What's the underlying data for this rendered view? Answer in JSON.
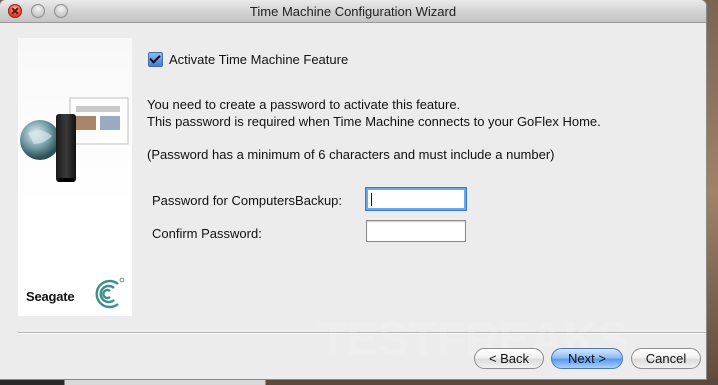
{
  "window": {
    "title": "Time Machine Configuration Wizard"
  },
  "sidebar": {
    "brand": "Seagate"
  },
  "content": {
    "activate_label": "Activate Time Machine Feature",
    "activate_checked": true,
    "paragraph_1": "You need to create a password to activate this feature.",
    "paragraph_2": "This password is required when Time Machine connects to your GoFlex Home.",
    "note": "(Password has a minimum of 6 characters and must include a number)",
    "password_label": "Password for ComputersBackup:",
    "password_value": "",
    "confirm_label": "Confirm Password:",
    "confirm_value": ""
  },
  "buttons": {
    "back": "< Back",
    "next": "Next >",
    "cancel": "Cancel"
  },
  "watermark": "TESTFREAKS"
}
